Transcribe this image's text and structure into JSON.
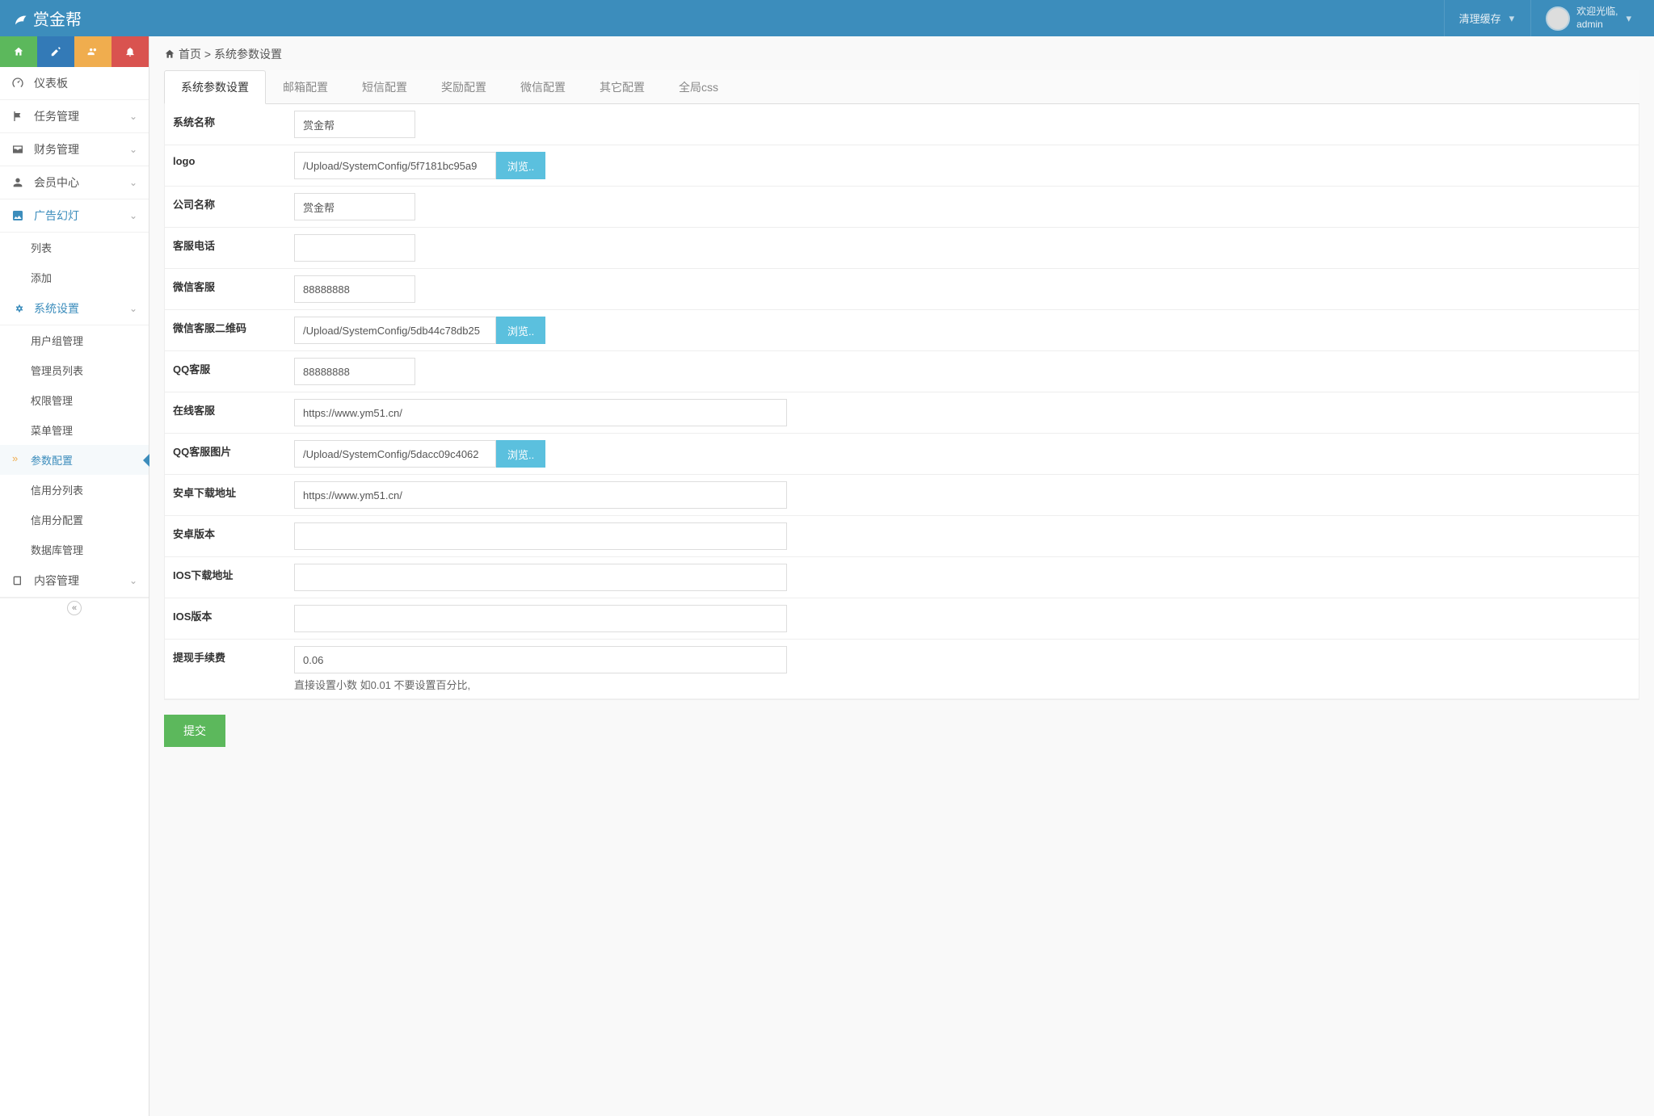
{
  "header": {
    "brand": "赏金帮",
    "clear_cache": "清理缓存",
    "welcome": "欢迎光临,",
    "user": "admin"
  },
  "sidebar": {
    "dashboard": "仪表板",
    "tasks": "任务管理",
    "finance": "财务管理",
    "member": "会员中心",
    "ads": "广告幻灯",
    "ads_sub": {
      "list": "列表",
      "add": "添加"
    },
    "system": "系统设置",
    "system_sub": {
      "usergroup": "用户组管理",
      "adminlist": "管理员列表",
      "permission": "权限管理",
      "menu": "菜单管理",
      "params": "参数配置",
      "creditlist": "信用分列表",
      "creditconfig": "信用分配置",
      "dbmgmt": "数据库管理"
    },
    "content": "内容管理"
  },
  "breadcrumb": {
    "home": "首页",
    "sep": ">",
    "current": "系统参数设置"
  },
  "tabs": {
    "system": "系统参数设置",
    "email": "邮箱配置",
    "sms": "短信配置",
    "reward": "奖励配置",
    "wechat": "微信配置",
    "other": "其它配置",
    "css": "全局css"
  },
  "form": {
    "browse": "浏览..",
    "sys_name_label": "系统名称",
    "sys_name": "赏金帮",
    "logo_label": "logo",
    "logo": "/Upload/SystemConfig/5f7181bc95a9",
    "company_label": "公司名称",
    "company": "赏金帮",
    "phone_label": "客服电话",
    "phone": "",
    "wechat_label": "微信客服",
    "wechat": "88888888",
    "wechat_qr_label": "微信客服二维码",
    "wechat_qr": "/Upload/SystemConfig/5db44c78db25",
    "qq_label": "QQ客服",
    "qq": "88888888",
    "online_label": "在线客服",
    "online": "https://www.ym51.cn/",
    "qqimg_label": "QQ客服图片",
    "qqimg": "/Upload/SystemConfig/5dacc09c4062",
    "android_url_label": "安卓下载地址",
    "android_url": "https://www.ym51.cn/",
    "android_ver_label": "安卓版本",
    "android_ver": "",
    "ios_url_label": "IOS下载地址",
    "ios_url": "",
    "ios_ver_label": "IOS版本",
    "ios_ver": "",
    "fee_label": "提现手续费",
    "fee": "0.06",
    "fee_help": "直接设置小数 如0.01 不要设置百分比,",
    "submit": "提交"
  }
}
